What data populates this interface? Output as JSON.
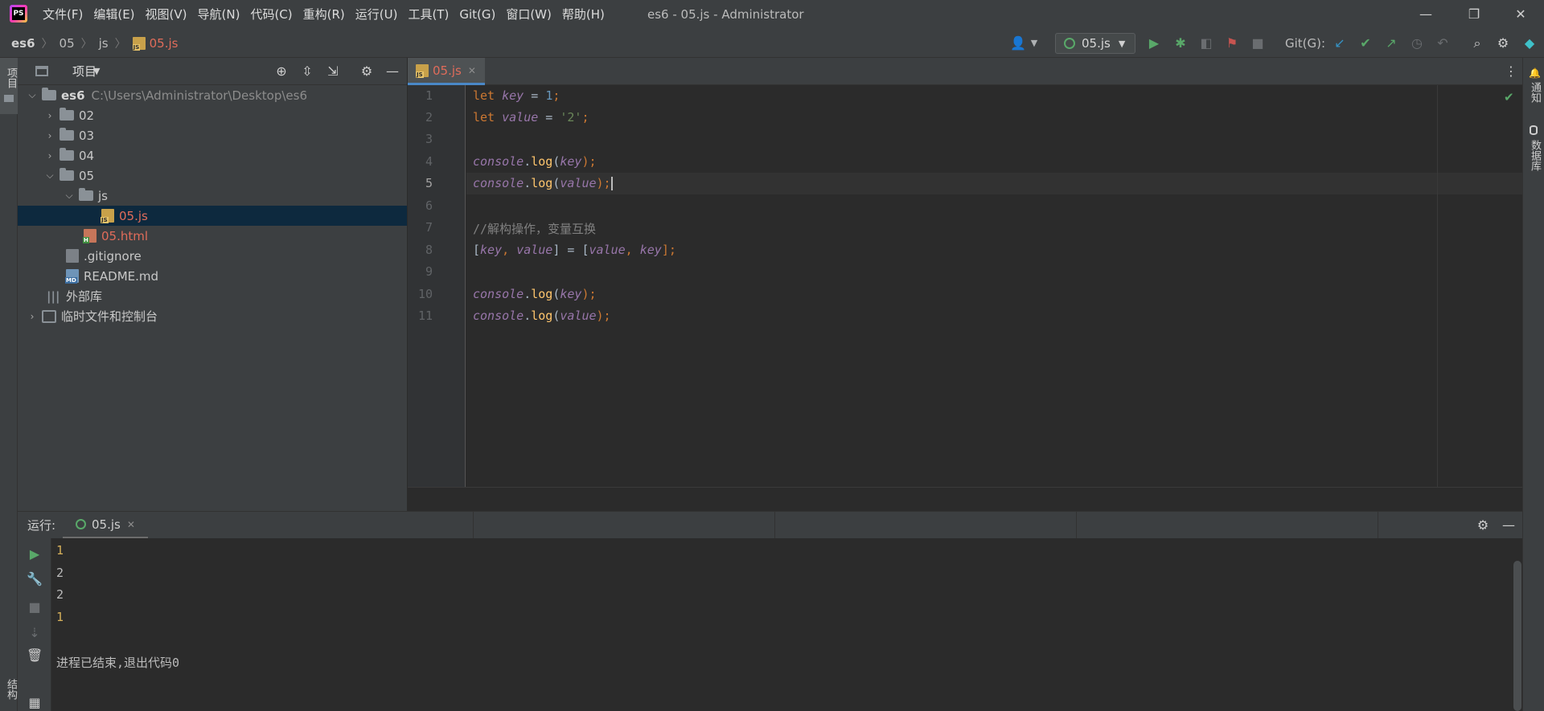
{
  "app": {
    "logo_text": "PS",
    "window_title": "es6 - 05.js - Administrator",
    "menu": [
      "文件(F)",
      "编辑(E)",
      "视图(V)",
      "导航(N)",
      "代码(C)",
      "重构(R)",
      "运行(U)",
      "工具(T)",
      "Git(G)",
      "窗口(W)",
      "帮助(H)"
    ],
    "window_controls": [
      "—",
      "❐",
      "✕"
    ]
  },
  "navbar": {
    "breadcrumb": [
      "es6",
      "05",
      "js",
      "05.js"
    ],
    "run_config": "05.js",
    "git_label": "Git(G):"
  },
  "left_strip": {
    "project_tab": "项目",
    "structure_tab": "结构"
  },
  "right_strip": {
    "notifications_tab": "通知",
    "database_tab": "数据库"
  },
  "project_panel": {
    "title": "项目",
    "tree": [
      {
        "label": "es6",
        "path": "C:\\Users\\Administrator\\Desktop\\es6"
      },
      {
        "label": "02"
      },
      {
        "label": "03"
      },
      {
        "label": "04"
      },
      {
        "label": "05"
      },
      {
        "label": "js"
      },
      {
        "label": "05.js"
      },
      {
        "label": "05.html"
      },
      {
        "label": ".gitignore"
      },
      {
        "label": "README.md"
      },
      {
        "label": "外部库"
      },
      {
        "label": "临时文件和控制台"
      }
    ]
  },
  "editor": {
    "tab": "05.js",
    "line_numbers": [
      "1",
      "2",
      "3",
      "4",
      "5",
      "6",
      "7",
      "8",
      "9",
      "10",
      "11"
    ],
    "current_line": 5,
    "code": {
      "l1": {
        "kw": "let",
        "var": "key",
        "eq": " = ",
        "val": "1",
        "end": ";"
      },
      "l2": {
        "kw": "let",
        "var": "value",
        "eq": " = ",
        "val": "'2'",
        "end": ";"
      },
      "l4": {
        "obj": "console",
        "dot": ".",
        "fn": "log",
        "open": "(",
        "arg": "key",
        "close": ");"
      },
      "l5": {
        "obj": "console",
        "dot": ".",
        "fn": "log",
        "open": "(",
        "arg": "value",
        "close": ");"
      },
      "l7": {
        "comment": "//解构操作，变量互换"
      },
      "l8": {
        "open": "[",
        "a": "key",
        "comma1": ", ",
        "b": "value",
        "mid": "] = [",
        "c": "value",
        "comma2": ", ",
        "d": "key",
        "close": "];"
      },
      "l10": {
        "obj": "console",
        "dot": ".",
        "fn": "log",
        "open": "(",
        "arg": "key",
        "close": ");"
      },
      "l11": {
        "obj": "console",
        "dot": ".",
        "fn": "log",
        "open": "(",
        "arg": "value",
        "close": ");"
      }
    }
  },
  "run_panel": {
    "label": "运行:",
    "tab": "05.js",
    "output": [
      "1",
      "2",
      "2",
      "1"
    ],
    "exit_message": "进程已结束,退出代码0"
  },
  "colors": {
    "accent": "#4a88c7",
    "keyword": "#cc7832",
    "variable": "#9876aa",
    "run_green": "#59a869",
    "current_file": "#e06c5a"
  }
}
